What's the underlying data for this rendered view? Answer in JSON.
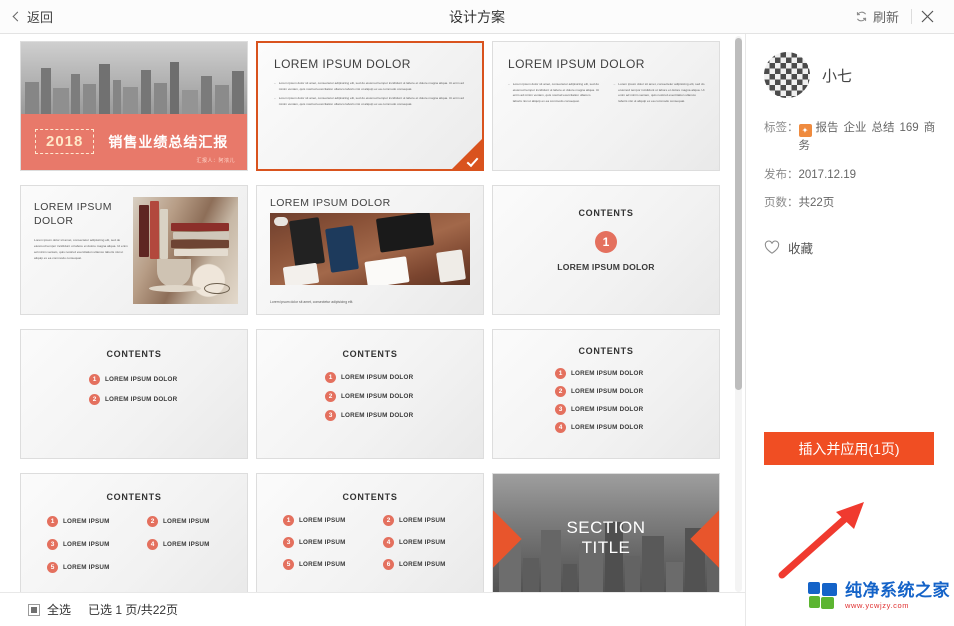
{
  "header": {
    "back_label": "返回",
    "title": "设计方案",
    "refresh_label": "刷新",
    "close_label": "✕"
  },
  "sidebar": {
    "user_name": "小七",
    "tags_key": "标签：",
    "tags": [
      "报告",
      "企业",
      "总结",
      "169",
      "商务"
    ],
    "publish_key": "发布：",
    "publish_value": "2017.12.19",
    "pages_key": "页数：",
    "pages_value": "共22页",
    "favorite_label": "收藏",
    "apply_button": "插入并应用(1页)",
    "watermark_main": "纯净系统之家",
    "watermark_sub": "www.ycwjzy.com"
  },
  "footer": {
    "select_all_label": "全选",
    "status": "已选 1 页/共22页"
  },
  "colors": {
    "accent_orange": "#f04e23",
    "slide_orange": "#e8796a",
    "number_orange": "#e4705e",
    "selected_border": "#d9531e",
    "arrow_red": "#f03a2f"
  },
  "slides": [
    {
      "index": 1,
      "type": "cover",
      "selected": false,
      "year": "2018",
      "title": "销售业绩总结汇报",
      "subtitle": "汇报人：阿浓儿"
    },
    {
      "index": 2,
      "type": "text-one-column",
      "selected": true,
      "title": "LOREM IPSUM DOLOR",
      "paragraphs": [
        "Lorem ipsum dolor sit amet, consectetur adipisicing elit, sed do eiusmod tempor incididunt ut labore et dolore magna aliqua. Ut enim ad minim veniam, quis nostrud exercitation ullamco laboris nisi ut aliquip ex ea commodo consequat.",
        "Lorem ipsum dolor sit amet, consectetur adipisicing elit, sed do eiusmod tempor incididunt ut labore et dolore magna aliqua. Ut enim ad minim veniam, quis nostrud exercitation ullamco laboris nisi ut aliquip ex ea commodo consequat."
      ]
    },
    {
      "index": 3,
      "type": "text-two-column",
      "selected": false,
      "title": "LOREM IPSUM DOLOR",
      "paragraphs": [
        "Lorem ipsum dolor sit amet, consectetur adipisicing elit, sed do eiusmod tempor incididunt ut labore et dolore magna aliqua. Ut enim ad minim veniam, quis nostrud exercitation ullamco laboris nisi ut aliquip ex ea commodo consequat.",
        "Lorem ipsum dolor sit amet, consectetur adipisicing elit, sed do eiusmod tempor incididunt ut labore et dolore magna aliqua. Ut enim ad minim veniam, quis nostrud exercitation ullamco laboris nisi ut aliquip ex ea commodo consequat."
      ]
    },
    {
      "index": 4,
      "type": "photo-books",
      "selected": false,
      "title": "LOREM IPSUM DOLOR",
      "paragraphs": [
        "Lorem ipsum dolor sit amet, consectetur adipisicing elit, sed do eiusmod tempor incididunt ut labore et dolore magna aliqua. Ut enim ad minim veniam, quis nostrud exercitation ullamco laboris nisi ut aliquip ex ea commodo consequat."
      ]
    },
    {
      "index": 5,
      "type": "photo-desk",
      "selected": false,
      "title": "LOREM IPSUM DOLOR",
      "caption": "Lorem ipsum dolor sit amet, consectetur adipisicing elit."
    },
    {
      "index": 6,
      "type": "contents-hero",
      "selected": false,
      "heading": "CONTENTS",
      "number": "1",
      "item_label": "LOREM IPSUM DOLOR"
    },
    {
      "index": 7,
      "type": "contents-list",
      "selected": false,
      "heading": "CONTENTS",
      "items": [
        {
          "num": "1",
          "label": "LOREM IPSUM DOLOR"
        },
        {
          "num": "2",
          "label": "LOREM IPSUM DOLOR"
        }
      ]
    },
    {
      "index": 8,
      "type": "contents-list",
      "selected": false,
      "heading": "CONTENTS",
      "items": [
        {
          "num": "1",
          "label": "LOREM IPSUM DOLOR"
        },
        {
          "num": "2",
          "label": "LOREM IPSUM DOLOR"
        },
        {
          "num": "3",
          "label": "LOREM IPSUM DOLOR"
        }
      ]
    },
    {
      "index": 9,
      "type": "contents-list",
      "selected": false,
      "heading": "CONTENTS",
      "items": [
        {
          "num": "1",
          "label": "LOREM IPSUM DOLOR"
        },
        {
          "num": "2",
          "label": "LOREM IPSUM DOLOR"
        },
        {
          "num": "3",
          "label": "LOREM IPSUM DOLOR"
        },
        {
          "num": "4",
          "label": "LOREM IPSUM DOLOR"
        }
      ]
    },
    {
      "index": 10,
      "type": "contents-grid",
      "selected": false,
      "heading": "CONTENTS",
      "items": [
        {
          "num": "1",
          "label": "LOREM IPSUM"
        },
        {
          "num": "2",
          "label": "LOREM IPSUM"
        },
        {
          "num": "3",
          "label": "LOREM IPSUM"
        },
        {
          "num": "4",
          "label": "LOREM IPSUM"
        },
        {
          "num": "5",
          "label": "LOREM IPSUM"
        }
      ]
    },
    {
      "index": 11,
      "type": "contents-grid",
      "selected": false,
      "heading": "CONTENTS",
      "items": [
        {
          "num": "1",
          "label": "LOREM IPSUM"
        },
        {
          "num": "2",
          "label": "LOREM IPSUM"
        },
        {
          "num": "3",
          "label": "LOREM IPSUM"
        },
        {
          "num": "4",
          "label": "LOREM IPSUM"
        },
        {
          "num": "5",
          "label": "LOREM IPSUM"
        },
        {
          "num": "6",
          "label": "LOREM IPSUM"
        }
      ]
    },
    {
      "index": 12,
      "type": "section-divider",
      "selected": false,
      "line1": "SECTION",
      "line2": "TITLE"
    }
  ]
}
